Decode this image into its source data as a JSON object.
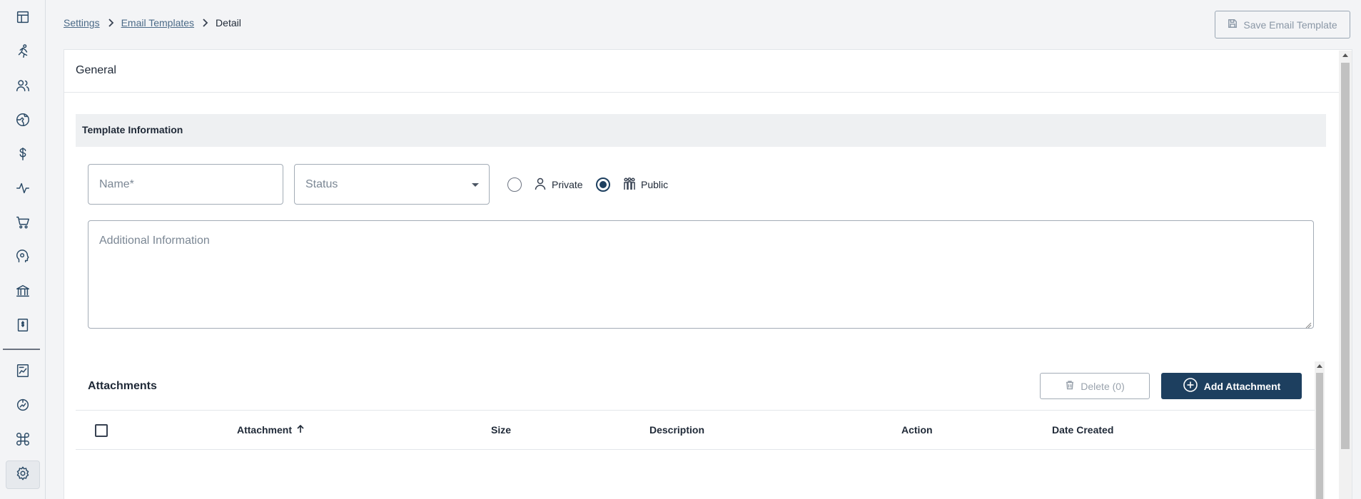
{
  "sidebar": {
    "items": [
      {
        "icon": "layout-icon"
      },
      {
        "icon": "running-person-icon"
      },
      {
        "icon": "users-icon"
      },
      {
        "icon": "globe-icon"
      },
      {
        "icon": "dollar-icon"
      },
      {
        "icon": "activity-icon"
      },
      {
        "icon": "cart-icon"
      },
      {
        "icon": "head-icon"
      },
      {
        "icon": "bank-icon"
      },
      {
        "icon": "invoice-icon"
      },
      {
        "icon": "report-icon"
      },
      {
        "icon": "chart-globe-icon"
      },
      {
        "icon": "command-icon"
      },
      {
        "icon": "gear-icon",
        "active": true
      }
    ]
  },
  "breadcrumb": {
    "items": [
      "Settings",
      "Email Templates"
    ],
    "current": "Detail"
  },
  "header": {
    "save_label": "Save Email Template"
  },
  "panel": {
    "title": "General",
    "section_title": "Template Information"
  },
  "form": {
    "name_placeholder": "Name*",
    "status_placeholder": "Status",
    "visibility": {
      "options": [
        "Private",
        "Public"
      ],
      "selected": "Public"
    },
    "info_placeholder": "Additional Information"
  },
  "attachments": {
    "title": "Attachments",
    "delete_label": "Delete (0)",
    "add_label": "Add Attachment",
    "columns": [
      "Attachment",
      "Size",
      "Description",
      "Action",
      "Date Created"
    ],
    "rows": []
  },
  "colors": {
    "primary": "#1d3f5f",
    "link": "#4b6a87",
    "background": "#f3f4f6"
  }
}
